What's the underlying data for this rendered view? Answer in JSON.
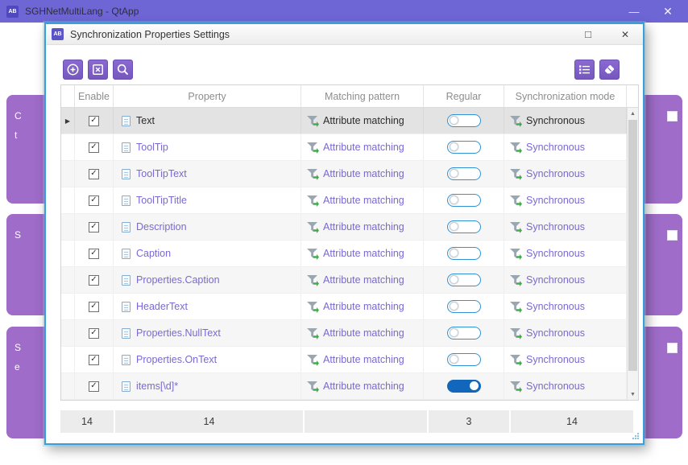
{
  "colors": {
    "titlebar_purple": "#6E66D5",
    "panel_purple": "#9F6CC9",
    "toolbar_button_purple": "#7D5FC3",
    "dialog_border_blue": "#3A9FD8",
    "property_link_purple": "#7B68D0",
    "toggle_on_blue": "#1266BB"
  },
  "icons": {
    "check": "✓",
    "row_arrow": "▶",
    "minimize": "—",
    "close": "✕",
    "maximize": "□",
    "scroll_up": "▲",
    "scroll_down": "▼"
  },
  "parent_window": {
    "app_icon_label": "AB",
    "title": "SGHNetMultiLang - QtApp",
    "panel_fragments": [
      "C\nt",
      "S",
      "S\ne"
    ]
  },
  "dialog": {
    "icon_label": "AB",
    "title": "Synchronization Properties Settings"
  },
  "table": {
    "columns": {
      "enable": "Enable",
      "property": "Property",
      "pattern": "Matching pattern",
      "regular": "Regular",
      "mode": "Synchronization mode"
    },
    "selected_row_index": 0,
    "rows": [
      {
        "label": "Text",
        "pattern": "Attribute matching",
        "regular": "off",
        "mode": "Synchronous"
      },
      {
        "label": "ToolTip",
        "pattern": "Attribute matching",
        "regular": "off",
        "mode": "Synchronous"
      },
      {
        "label": "ToolTipText",
        "pattern": "Attribute matching",
        "regular": "off",
        "mode": "Synchronous"
      },
      {
        "label": "ToolTipTitle",
        "pattern": "Attribute matching",
        "regular": "off",
        "mode": "Synchronous"
      },
      {
        "label": "Description",
        "pattern": "Attribute matching",
        "regular": "off",
        "mode": "Synchronous"
      },
      {
        "label": "Caption",
        "pattern": "Attribute matching",
        "regular": "off",
        "mode": "Synchronous"
      },
      {
        "label": "Properties.Caption",
        "pattern": "Attribute matching",
        "regular": "off",
        "mode": "Synchronous"
      },
      {
        "label": "HeaderText",
        "pattern": "Attribute matching",
        "regular": "off",
        "mode": "Synchronous"
      },
      {
        "label": "Properties.NullText",
        "pattern": "Attribute matching",
        "regular": "off",
        "mode": "Synchronous"
      },
      {
        "label": "Properties.OnText",
        "pattern": "Attribute matching",
        "regular": "off",
        "mode": "Synchronous"
      },
      {
        "label": "items[\\d]*",
        "pattern": "Attribute matching",
        "regular": "on",
        "mode": "Synchronous"
      }
    ],
    "footer": {
      "enable": "14",
      "property": "14",
      "pattern": "",
      "regular": "3",
      "mode": "14"
    }
  }
}
